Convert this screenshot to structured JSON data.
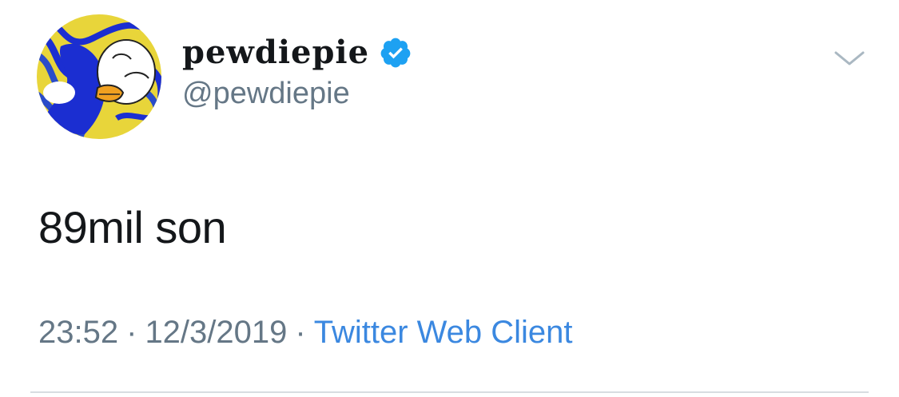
{
  "tweet": {
    "author": {
      "display_name": "pewdiepie",
      "handle": "@pewdiepie",
      "verified": true,
      "avatar_icon": "duck-avatar-icon"
    },
    "text": "89mil son",
    "time": "23:52",
    "date": "12/3/2019",
    "separator": "·",
    "source": "Twitter Web Client",
    "menu_icon": "chevron-down-icon"
  },
  "colors": {
    "text_primary": "#14171a",
    "text_secondary": "#657786",
    "link": "#3b88e0",
    "verified_badge": "#1da1f2",
    "divider": "#d8dde1",
    "avatar_blue": "#1b2ed1",
    "avatar_yellow": "#e8d53a"
  }
}
